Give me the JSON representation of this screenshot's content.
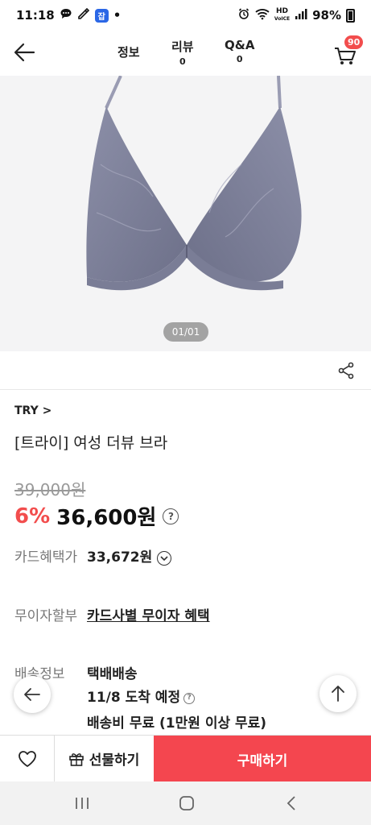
{
  "status_bar": {
    "time": "11:18",
    "battery": "98%",
    "hd_top": "HD",
    "hd_bottom": "VoICE",
    "app_badge": "잡",
    "dot": "•"
  },
  "header": {
    "tabs": [
      {
        "label": "정보",
        "count": ""
      },
      {
        "label": "리뷰",
        "count": "0"
      },
      {
        "label": "Q&A",
        "count": "0"
      }
    ],
    "cart_count": "90"
  },
  "gallery": {
    "page_indicator": "01/01"
  },
  "product": {
    "brand": "TRY >",
    "name": "[트라이] 여성 더뷰 브라",
    "original_price": "39,000원",
    "discount": "6%",
    "sale_price": "36,600원",
    "help_symbol": "?"
  },
  "info": {
    "card_label": "카드혜택가",
    "card_value": "33,672원",
    "installment_label": "무이자할부",
    "installment_value": "카드사별 무이자 혜택",
    "shipping_label": "배송정보",
    "shipping_method": "택배배송",
    "shipping_eta": "11/8 도착 예정",
    "shipping_fee": "배송비 무료 (1만원 이상 무료)"
  },
  "bottom_bar": {
    "gift_label": "선물하기",
    "buy_label": "구매하기"
  },
  "colors": {
    "accent": "#f4464f",
    "discount": "#f24d4d",
    "badge": "#f24d4d"
  }
}
